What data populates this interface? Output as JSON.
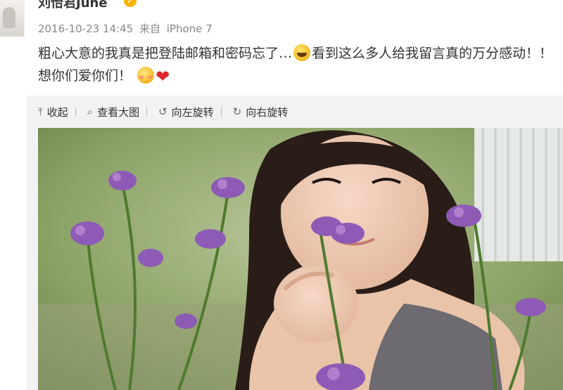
{
  "post": {
    "username": "刘怡君June",
    "timestamp": "2016-10-23 14:45",
    "source_prefix": "来自",
    "source": "iPhone 7",
    "text_part1": "粗心大意的我真是把登陆邮箱和密码忘了…",
    "text_part2": "看到这么多人给我留言真的万分感动！！想你们爱你们！"
  },
  "toolbar": {
    "collapse": "收起",
    "view_large": "查看大图",
    "rotate_left": "向左旋转",
    "rotate_right": "向右旋转"
  },
  "icons": {
    "verified": "verified-badge-icon",
    "laugh": "laughing-emoji-icon",
    "shy": "shy-emoji-icon",
    "heart": "heart-icon",
    "collapse": "collapse-up-arrow-icon",
    "search": "search-icon",
    "rotate_left": "rotate-left-icon",
    "rotate_right": "rotate-right-icon"
  },
  "colors": {
    "heart": "#e0262e",
    "verified": "#f5b400",
    "panel_bg": "#f2f2f5"
  }
}
